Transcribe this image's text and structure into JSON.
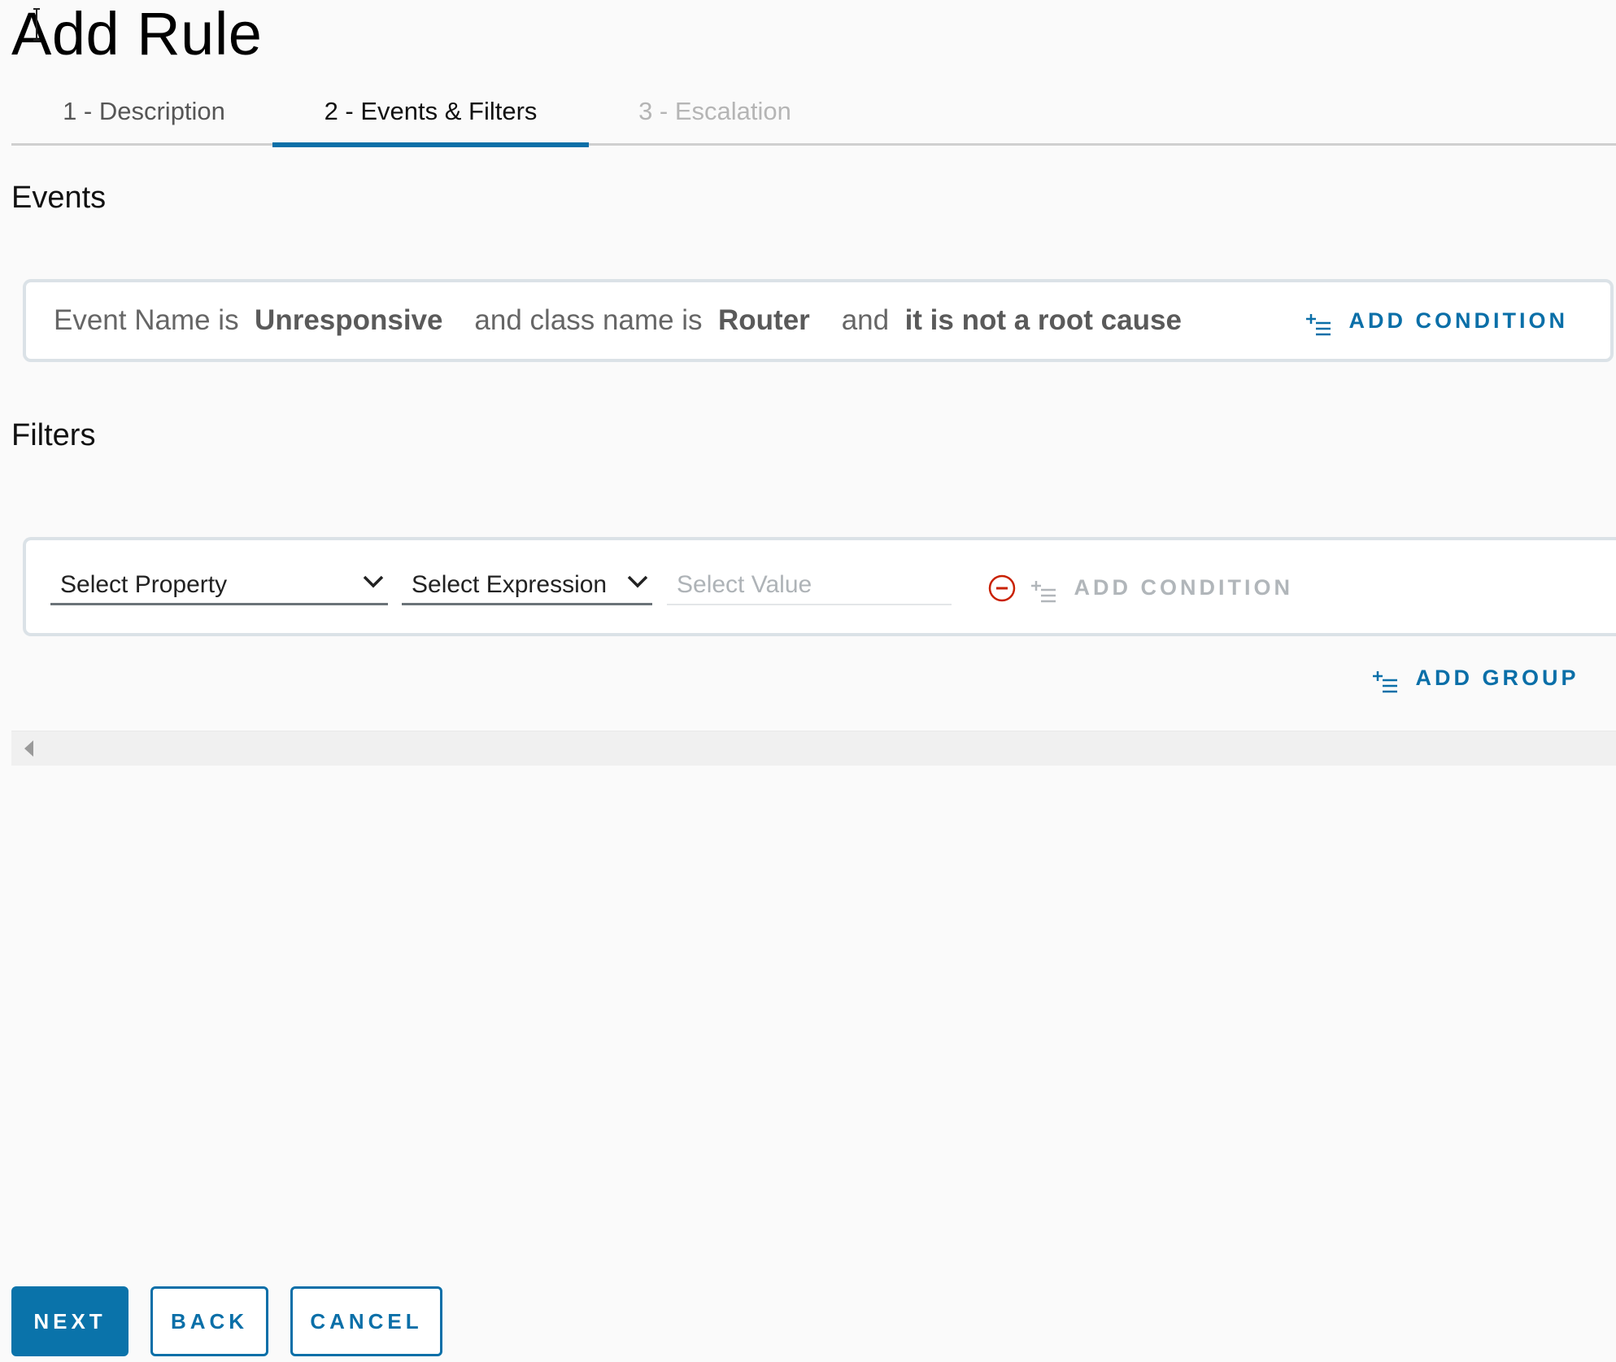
{
  "page": {
    "title": "Add Rule"
  },
  "wizard": {
    "steps": [
      {
        "label": "1 - Description",
        "state": "completed"
      },
      {
        "label": "2 - Events & Filters",
        "state": "active"
      },
      {
        "label": "3 - Escalation",
        "state": "disabled"
      }
    ]
  },
  "events": {
    "heading": "Events",
    "condition": {
      "prefix": "Event Name is",
      "event_name": "Unresponsive",
      "class_prefix": "and class name is",
      "class_name": "Router",
      "root_prefix": "and",
      "root_cause": "it is not a root cause"
    },
    "add_condition_label": "ADD CONDITION"
  },
  "filters": {
    "heading": "Filters",
    "property_select": {
      "value": "Select Property"
    },
    "expression_select": {
      "value": "Select Expression"
    },
    "value_input": {
      "placeholder": "Select Value",
      "value": ""
    },
    "add_condition_label": "ADD CONDITION",
    "add_condition_enabled": false,
    "add_group_label": "ADD GROUP"
  },
  "footer": {
    "next_label": "NEXT",
    "back_label": "BACK",
    "cancel_label": "CANCEL"
  },
  "colors": {
    "accent": "#0a6fa8",
    "primary_button": "#0a73aa",
    "danger": "#c92100",
    "disabled_text": "#b1b6ba",
    "background": "#fafafa"
  }
}
